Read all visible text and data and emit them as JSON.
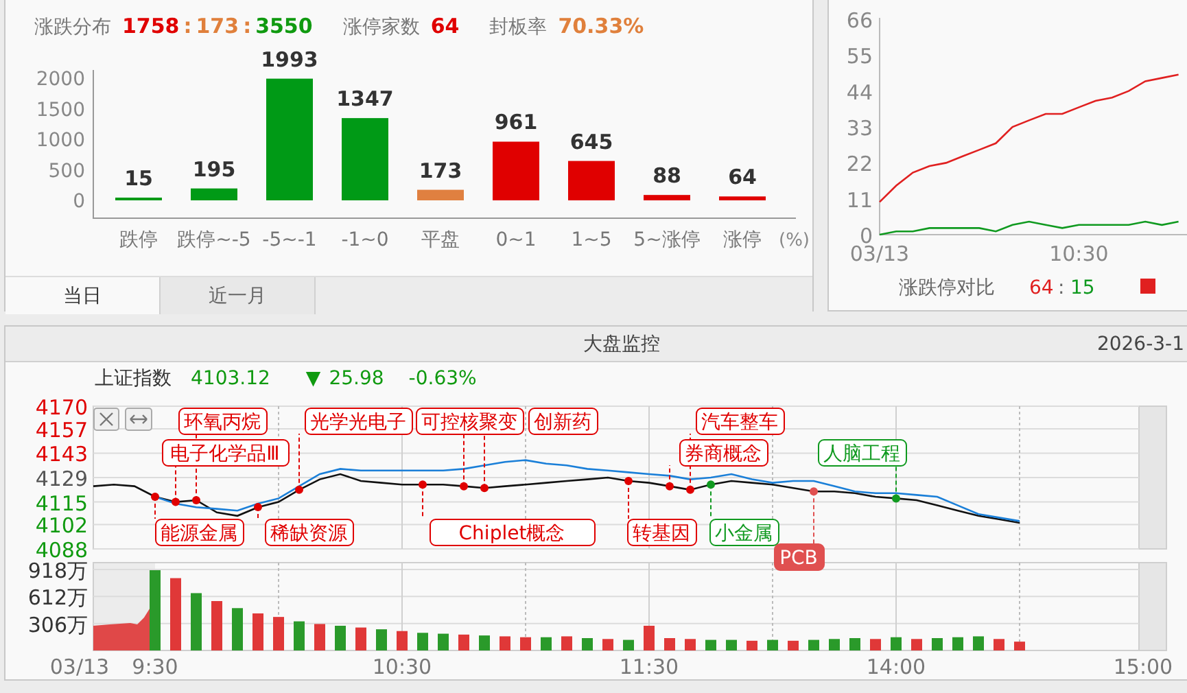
{
  "distribution_panel": {
    "summary": [
      {
        "label": "涨跌分布",
        "parts": [
          {
            "text": "1758",
            "kind": "up"
          },
          {
            "text": ":",
            "kind": "flat"
          },
          {
            "text": "173",
            "kind": "flat"
          },
          {
            "text": ":",
            "kind": "flat"
          },
          {
            "text": "3550",
            "kind": "down"
          }
        ]
      },
      {
        "label": "涨停家数",
        "parts": [
          {
            "text": "64",
            "kind": "up"
          }
        ]
      },
      {
        "label": "封板率",
        "parts": [
          {
            "text": "70.33%",
            "kind": "flat"
          }
        ]
      }
    ],
    "chart_data": {
      "type": "bar",
      "categories": [
        "跌停",
        "跌停~-5",
        "-5~-1",
        "-1~0",
        "平盘",
        "0~1",
        "1~5",
        "5~涨停",
        "涨停"
      ],
      "xlabel": "(%)",
      "series": [
        {
          "color": "#009a16",
          "values": [
            15,
            195,
            1993,
            1347,
            null,
            null,
            null,
            null,
            null
          ]
        },
        {
          "color": "#e08040",
          "values": [
            null,
            null,
            null,
            null,
            173,
            null,
            null,
            null,
            null
          ]
        },
        {
          "color": "#e00000",
          "values": [
            null,
            null,
            null,
            null,
            null,
            961,
            645,
            88,
            64
          ]
        }
      ],
      "ylim": [
        0,
        2000
      ],
      "yticks": [
        0,
        500,
        1000,
        1500,
        2000
      ],
      "data_labels": true
    },
    "tabs": [
      {
        "label": "当日",
        "selected": true
      },
      {
        "label": "近一月",
        "selected": false
      }
    ]
  },
  "limit_panel": {
    "chart_data": {
      "type": "line",
      "categories": [
        "03/13",
        null,
        null,
        null,
        null,
        null,
        null,
        null,
        null,
        null,
        null,
        null,
        "10:30",
        null,
        null,
        null,
        null,
        null,
        null
      ],
      "series": [
        {
          "color": "#e02020",
          "values": [
            10,
            15,
            19,
            21,
            22,
            24,
            26,
            28,
            33,
            35,
            37,
            37,
            39,
            41,
            42,
            44,
            47,
            48,
            49
          ]
        },
        {
          "color": "#109a20",
          "values": [
            0,
            1,
            1,
            2,
            2,
            2,
            2,
            1,
            3,
            4,
            3,
            2,
            3,
            3,
            3,
            3,
            4,
            3,
            4
          ]
        }
      ],
      "ylim": [
        0,
        66
      ],
      "yticks": [
        0,
        11,
        22,
        33,
        44,
        55,
        66
      ]
    },
    "legend": {
      "label": "涨跌停对比",
      "up": "64",
      "separator": ":",
      "down": "15"
    }
  },
  "monitor_panel": {
    "title": "大盘监控",
    "date": "2026-3-1",
    "index": {
      "name": "上证指数",
      "price": "4103.12",
      "arrow": "▼",
      "change": "25.98",
      "percent": "-0.63%",
      "falling": true
    },
    "price_chart": {
      "chart_data": {
        "type": "line",
        "grid": true,
        "series": [
          {
            "color": "#111111",
            "values": [
              null,
              4124,
              4125,
              4124,
              4118,
              4115,
              4116,
              4109,
              4107,
              4112,
              4115,
              4122,
              4128,
              4131,
              4127,
              4126,
              4125,
              4125,
              4125,
              4124,
              4123,
              4124,
              4125,
              4126,
              4127,
              4128,
              4129,
              4127,
              4126,
              4124,
              4122,
              4125,
              4127,
              4126,
              4125,
              4123,
              4121,
              4121,
              4120,
              4118,
              4117,
              4116,
              4113,
              4110,
              4107,
              4105,
              4103,
              null,
              null,
              null,
              null,
              null,
              null
            ]
          },
          {
            "color": "#1a7fd8",
            "values": [
              null,
              null,
              null,
              null,
              4118,
              4114,
              4112,
              4111,
              4110,
              4114,
              4117,
              4124,
              4131,
              4134,
              4133,
              4133,
              4133,
              4133,
              4133,
              4134,
              4136,
              4138,
              4139,
              4137,
              4136,
              4134,
              4133,
              4132,
              4131,
              4130,
              4128,
              4129,
              4131,
              4128,
              4126,
              4127,
              4127,
              4124,
              4121,
              4120,
              4120,
              4119,
              4118,
              4113,
              4108,
              4106,
              4104,
              null,
              null,
              null,
              null,
              null,
              null
            ]
          }
        ],
        "ylim": [
          4088,
          4170
        ],
        "yticks": [
          4170,
          4157,
          4143,
          4129,
          4115,
          4102,
          4088
        ]
      },
      "concept_tags": [
        {
          "text": "环氧丙烷",
          "color": "#e00000",
          "filled": false
        },
        {
          "text": "光学光电子",
          "color": "#e00000",
          "filled": false
        },
        {
          "text": "可控核聚变",
          "color": "#e00000",
          "filled": false
        },
        {
          "text": "创新药",
          "color": "#e00000",
          "filled": false
        },
        {
          "text": "汽车整车",
          "color": "#e00000",
          "filled": false
        },
        {
          "text": "电子化学品Ⅲ",
          "color": "#e00000",
          "filled": false
        },
        {
          "text": "券商概念",
          "color": "#e00000",
          "filled": false
        },
        {
          "text": "人脑工程",
          "color": "#109a20",
          "filled": false
        },
        {
          "text": "能源金属",
          "color": "#e00000",
          "filled": false
        },
        {
          "text": "稀缺资源",
          "color": "#e00000",
          "filled": false
        },
        {
          "text": "Chiplet概念",
          "color": "#e00000",
          "filled": false
        },
        {
          "text": "转基因",
          "color": "#e00000",
          "filled": false
        },
        {
          "text": "小金属",
          "color": "#109a20",
          "filled": false
        },
        {
          "text": "PCB",
          "color": "#e05050",
          "filled": true
        }
      ]
    },
    "volume_chart": {
      "chart_data": {
        "type": "bar",
        "grid": true,
        "categories": [
          "03/13",
          null,
          null,
          null,
          "9:30",
          null,
          null,
          null,
          null,
          null,
          null,
          null,
          null,
          null,
          null,
          null,
          "10:30",
          null,
          null,
          null,
          null,
          null,
          null,
          null,
          null,
          null,
          null,
          null,
          "11:30",
          null,
          null,
          null,
          null,
          null,
          null,
          null,
          null,
          null,
          null,
          null,
          "14:00",
          null,
          null,
          null,
          null,
          null,
          null,
          null,
          null,
          null,
          null,
          null,
          "15:00"
        ],
        "series": [
          {
            "color": "#e03838",
            "values": [
              null,
              null,
              null,
              null,
              null,
              820,
              null,
              560,
              null,
              420,
              380,
              null,
              300,
              null,
              260,
              null,
              220,
              null,
              null,
              180,
              null,
              160,
              150,
              null,
              160,
              null,
              130,
              null,
              280,
              140,
              130,
              null,
              null,
              110,
              null,
              110,
              null,
              null,
              null,
              130,
              null,
              130,
              null,
              null,
              null,
              130,
              100,
              null,
              null,
              null,
              null,
              null,
              null
            ]
          },
          {
            "color": "#2a9a2a",
            "values": [
              null,
              null,
              null,
              null,
              910,
              null,
              650,
              null,
              480,
              null,
              null,
              330,
              null,
              280,
              null,
              240,
              null,
              200,
              190,
              null,
              170,
              null,
              null,
              150,
              null,
              140,
              null,
              120,
              null,
              null,
              null,
              120,
              120,
              null,
              120,
              null,
              120,
              130,
              140,
              null,
              150,
              null,
              140,
              150,
              160,
              null,
              null,
              null,
              null,
              null,
              null,
              null,
              null
            ]
          }
        ],
        "ylim": [
          0,
          918
        ],
        "yticks": [
          {
            "value": 306,
            "label": "306万"
          },
          {
            "value": 612,
            "label": "612万"
          },
          {
            "value": 918,
            "label": "918万"
          }
        ]
      }
    }
  }
}
